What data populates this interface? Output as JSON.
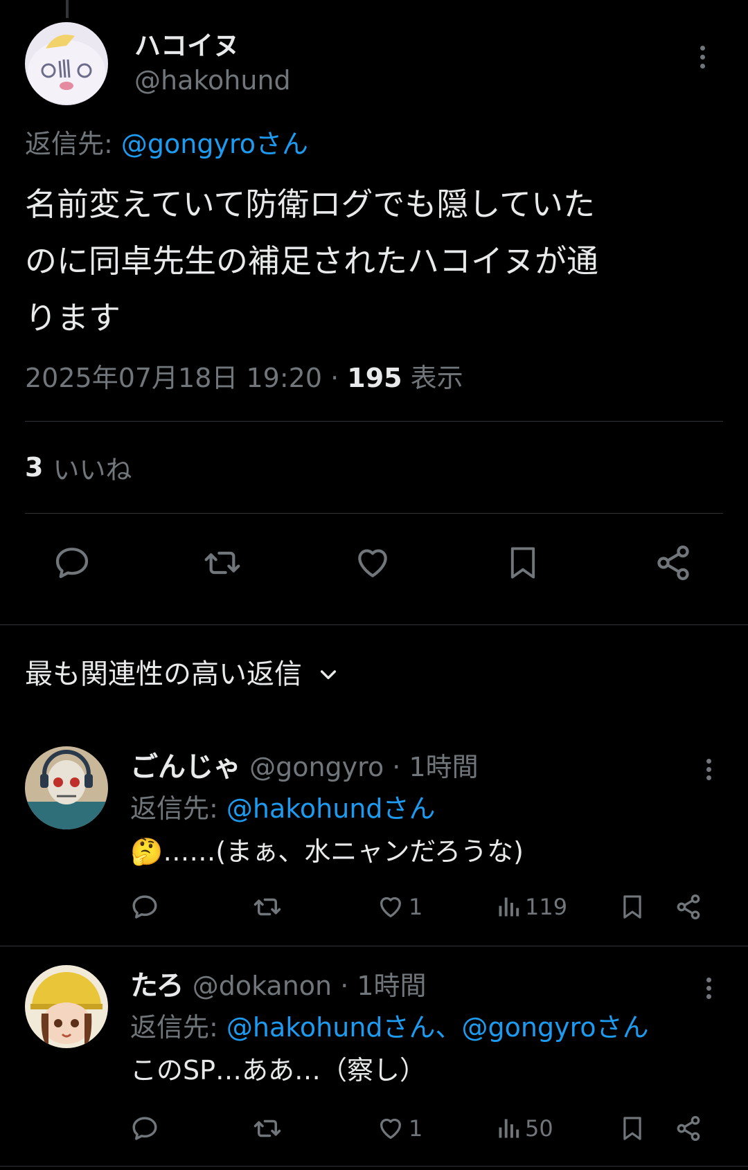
{
  "main_tweet": {
    "display_name": "ハコイヌ",
    "handle": "@hakohund",
    "reply_to_prefix": "返信先: ",
    "reply_to_link": "@gongyroさん",
    "text_lines": [
      "名前変えていて防衛ログでも隠していた",
      "のに同卓先生の補足されたハコイヌが通",
      "ります"
    ],
    "datetime": "2025年07月18日 19:20",
    "separator": " · ",
    "view_count": "195",
    "view_label": " 表示",
    "like_count": "3",
    "like_label": "いいね"
  },
  "sort": {
    "label": "最も関連性の高い返信"
  },
  "replies": [
    {
      "display_name": "ごんじゃ",
      "handle": "@gongyro",
      "time": " · 1時間",
      "reply_to_prefix": "返信先: ",
      "reply_to_link": "@hakohundさん",
      "text": "🤔……(まぁ、水ニャンだろうな)",
      "likes": "1",
      "views": "119"
    },
    {
      "display_name": "たろ",
      "handle": "@dokanon",
      "time": " · 1時間",
      "reply_to_prefix": "返信先: ",
      "reply_to_link": "@hakohundさん、@gongyroさん",
      "text": "このSP…ああ…（察し）",
      "likes": "1",
      "views": "50"
    }
  ],
  "colors": {
    "background": "#000000",
    "text": "#e7e9ea",
    "secondary": "#71767b",
    "link": "#1d9bf0",
    "divider": "#2f3336"
  }
}
